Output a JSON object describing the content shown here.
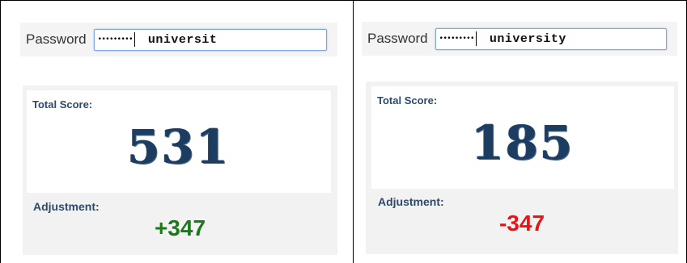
{
  "panels": [
    {
      "password": {
        "label": "Password",
        "masked_value": "•••••••••",
        "suggestion": "universit"
      },
      "score": {
        "title": "Total Score:",
        "value": "531"
      },
      "adjustment": {
        "label": "Adjustment:",
        "value": "+347",
        "color": "#1a7a1a"
      }
    },
    {
      "password": {
        "label": "Password",
        "masked_value": "•••••••••",
        "suggestion": "university"
      },
      "score": {
        "title": "Total Score:",
        "value": "185"
      },
      "adjustment": {
        "label": "Adjustment:",
        "value": "-347",
        "color": "#ee1111"
      }
    }
  ]
}
